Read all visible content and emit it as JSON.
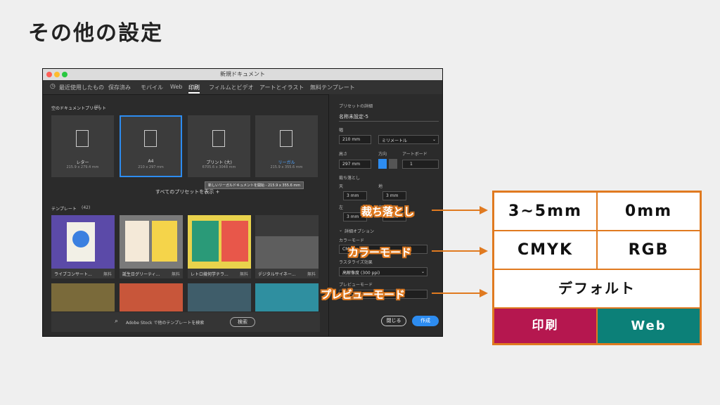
{
  "slide_title": "その他の設定",
  "window": {
    "title": "新規ドキュメント",
    "tabs": [
      {
        "label": "最近使用したもの"
      },
      {
        "label": "保存済み"
      },
      {
        "label": "モバイル"
      },
      {
        "label": "Web"
      },
      {
        "label": "印刷"
      },
      {
        "label": "フィルムとビデオ"
      },
      {
        "label": "アートとイラスト"
      },
      {
        "label": "無料テンプレート"
      }
    ],
    "active_tab": "印刷"
  },
  "presets": {
    "heading": "空のドキュメントプリセット",
    "count": "(9)",
    "items": [
      {
        "name": "レター",
        "size": "215.9 x 279.4 mm"
      },
      {
        "name": "A4",
        "size": "210 x 297 mm"
      },
      {
        "name": "プリント (大)",
        "size": "6705.6 x 3048 mm"
      },
      {
        "name": "リーガル",
        "size": "215.9 x 355.6 mm"
      }
    ],
    "view_all": "すべてのプリセットを表示 +",
    "tooltip": "新しいリーガルドキュメントを開始 - 215.9 x 355.6 mm"
  },
  "templates": {
    "heading": "テンプレート",
    "count": "(42)",
    "items": [
      {
        "name": "ライブコンサート...",
        "badge": "無料"
      },
      {
        "name": "誕生日グリーティ...",
        "badge": "無料"
      },
      {
        "name": "レトロ幾何学チラ...",
        "badge": "無料"
      },
      {
        "name": "デジタルサイネー...",
        "badge": "無料"
      }
    ],
    "search_placeholder": "Adobe Stock で他のテンプレートを検索",
    "search_button": "検索"
  },
  "details": {
    "heading": "プリセットの詳細",
    "name": "名称未設定-5",
    "width_label": "幅",
    "width": "210 mm",
    "unit": "ミリメートル",
    "height_label": "高さ",
    "height": "297 mm",
    "orientation_label": "方向",
    "artboard_label": "アートボード",
    "artboard_value": "1",
    "bleed_label": "裁ち落とし",
    "bleed_top_label": "天",
    "bleed_bottom_label": "地",
    "bleed_left_label": "左",
    "bleed_right_label": "右",
    "bleed_top": "3 mm",
    "bleed_bottom": "3 mm",
    "bleed_left": "3 mm",
    "bleed_right": "3 mm",
    "advanced_label": "詳細オプション",
    "color_mode_label": "カラーモード",
    "color_mode": "CMYK",
    "raster_label": "ラスタライズ効果",
    "raster_value": "高解像度 (300 ppi)",
    "preview_label": "プレビューモード",
    "preview_value": "デフォルト",
    "close_button": "閉じる",
    "create_button": "作成"
  },
  "annotations": {
    "bleed": "裁ち落とし",
    "color_mode": "カラーモード",
    "preview_mode": "プレビューモード"
  },
  "summary": {
    "print_bleed": "3~5mm",
    "web_bleed": "0mm",
    "print_color": "CMYK",
    "web_color": "RGB",
    "preview": "デフォルト",
    "print_label": "印刷",
    "web_label": "Web",
    "print_color_hex": "#b5174f",
    "web_color_hex": "#0c8078",
    "accent_hex": "#e07a20"
  }
}
